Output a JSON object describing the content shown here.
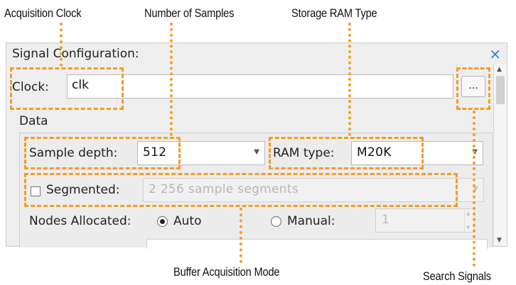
{
  "callouts": {
    "acquisition_clock": "Acquisition Clock",
    "number_of_samples": "Number of Samples",
    "storage_ram_type": "Storage RAM Type",
    "buffer_acquisition_mode": "Buffer Acquisition Mode",
    "search_signals": "Search Signals"
  },
  "panel": {
    "title": "Signal Configuration:",
    "close_icon": "×"
  },
  "clock": {
    "label": "Clock:",
    "value": "clk",
    "browse_label": "..."
  },
  "data_section": {
    "label": "Data",
    "sample_depth_label": "Sample depth:",
    "sample_depth_value": "512",
    "ram_type_label": "RAM type:",
    "ram_type_value": "M20K",
    "segmented_label": "Segmented:",
    "segmented_value": "2  256 sample segments",
    "nodes_allocated_label": "Nodes Allocated:",
    "auto_label": "Auto",
    "manual_label": "Manual:",
    "manual_value": "1"
  },
  "colors": {
    "callout_accent": "#f39c27",
    "close_icon": "#2f7bd3"
  }
}
